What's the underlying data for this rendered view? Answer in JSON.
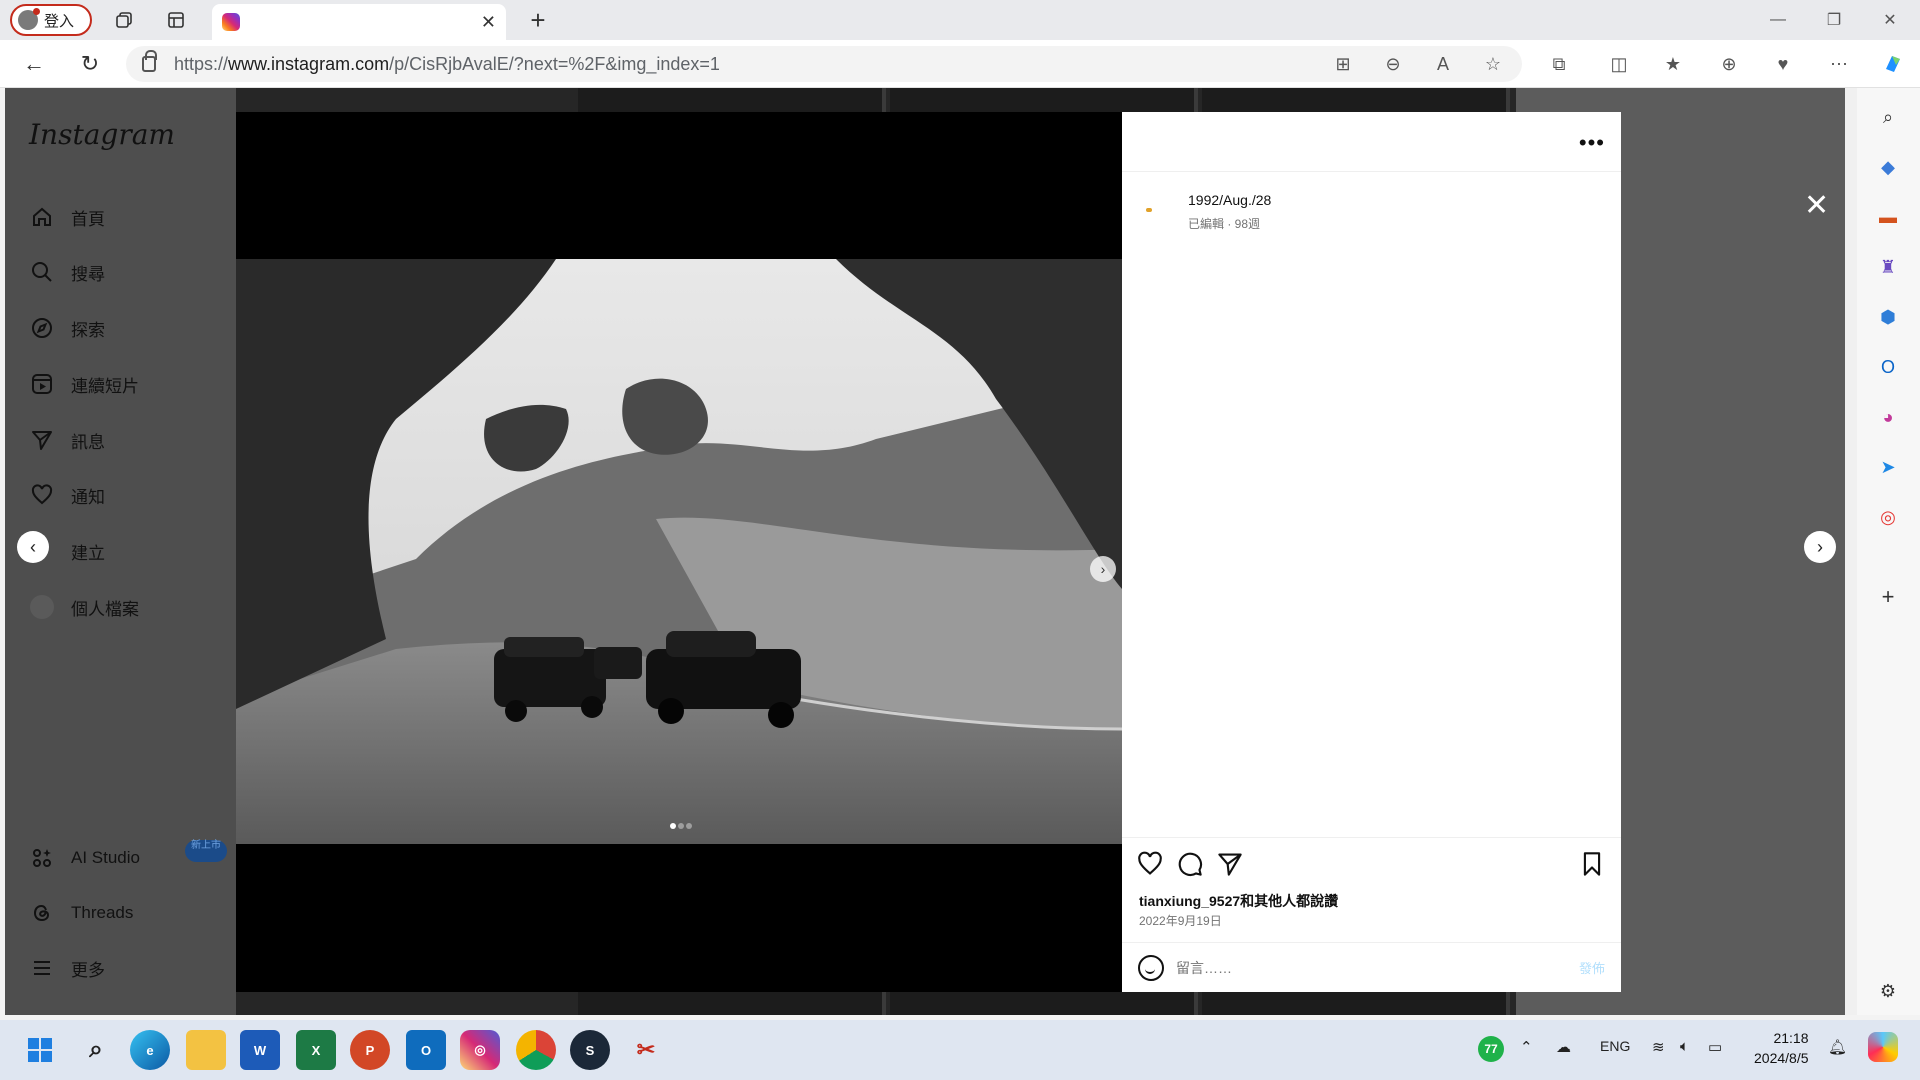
{
  "browser": {
    "profile_label": "登入",
    "tab_title": "",
    "url_prefix": "https://",
    "url_domain": "www.instagram.com",
    "url_path": "/p/CisRjbAvalE/?next=%2F&img_index=1"
  },
  "instagram": {
    "logo": "Instagram",
    "nav": [
      {
        "label": "首頁",
        "icon": "home-icon"
      },
      {
        "label": "搜尋",
        "icon": "search-icon"
      },
      {
        "label": "探索",
        "icon": "compass-icon"
      },
      {
        "label": "連續短片",
        "icon": "reels-icon"
      },
      {
        "label": "訊息",
        "icon": "send-icon"
      },
      {
        "label": "通知",
        "icon": "heart-icon"
      },
      {
        "label": "建立",
        "icon": "plus-icon"
      },
      {
        "label": "個人檔案",
        "icon": "avatar-icon"
      }
    ],
    "bottom_nav": [
      {
        "label": "AI Studio",
        "icon": "ai-studio-icon"
      },
      {
        "label": "Threads",
        "icon": "threads-icon"
      },
      {
        "label": "更多",
        "icon": "menu-icon"
      }
    ],
    "new_badge": "新上市"
  },
  "post": {
    "caption": "1992/Aug./28",
    "caption_meta": "已編輯 · 98週",
    "likes_text": "tianxiung_9527和其他人都說讚",
    "date": "2022年9月19日",
    "comment_placeholder": "留言……",
    "post_button": "發佈",
    "image_dots": 3,
    "image_index": 1
  },
  "taskbar": {
    "battery_badge": "77",
    "language": "ENG",
    "time": "21:18",
    "date": "2024/8/5"
  },
  "colors": {
    "accent_blue": "#0095f6",
    "instagram_gradient": [
      "#feda75",
      "#fa7e1e",
      "#d62976",
      "#962fbf",
      "#4f5bd5"
    ]
  }
}
